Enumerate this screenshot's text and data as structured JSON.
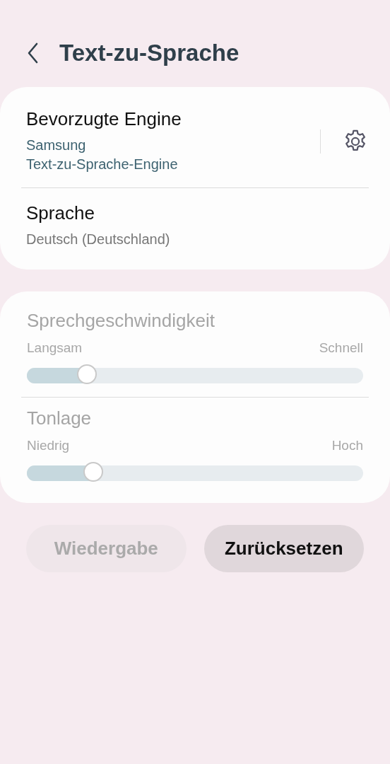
{
  "header": {
    "title": "Text-zu-Sprache"
  },
  "preferences": [
    {
      "kind": "engine",
      "title": "Bevorzugte Engine",
      "summary": [
        "Samsung",
        "Text-zu-Sprache-Engine"
      ]
    },
    {
      "kind": "plain",
      "title": "Sprache",
      "summary": [
        "Deutsch (Deutschland)"
      ]
    }
  ],
  "sliders_disabled": true,
  "sliders": [
    {
      "label": "Sprechgeschwindigkeit",
      "min_label": "Langsam",
      "max_label": "Schnell",
      "level": 0.18
    },
    {
      "label": "Tonlage",
      "min_label": "Niedrig",
      "max_label": "Hoch",
      "level": 0.2
    }
  ],
  "buttons": [
    {
      "label": "Wiedergabe",
      "disabled": true
    },
    {
      "label": "Zurücksetzen",
      "disabled": false
    }
  ]
}
